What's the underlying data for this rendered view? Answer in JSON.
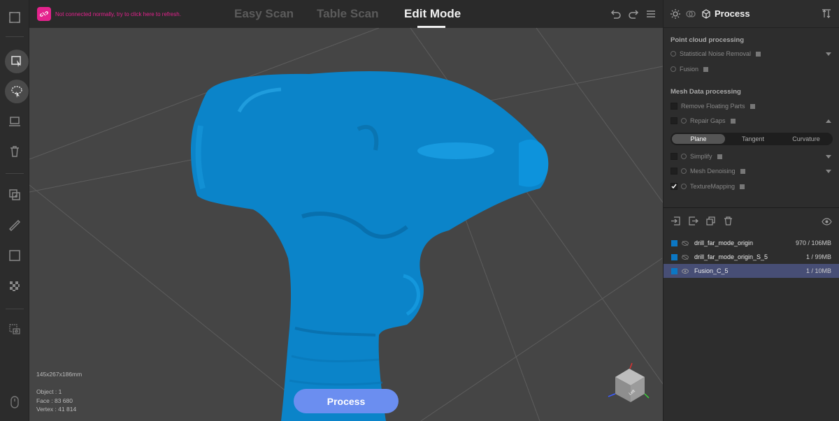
{
  "topbar": {
    "connection_warning": "Not connected normally, try to click here to refresh.",
    "tabs": [
      "Easy Scan",
      "Table Scan",
      "Edit Mode"
    ],
    "active_tab": "Edit Mode"
  },
  "viewport": {
    "dimensions": "145x267x186mm",
    "object": "Object : 1",
    "face": "Face : 83 680",
    "vertex": "Vertex : 41 814",
    "process_button": "Process",
    "cube_label": "Left"
  },
  "panel": {
    "title": "Process",
    "point_cloud": {
      "title": "Point cloud processing",
      "items": [
        "Statistical Noise Removal",
        "Fusion"
      ]
    },
    "mesh": {
      "title": "Mesh Data processing",
      "items": [
        "Remove Floating Parts",
        "Repair Gaps",
        "Simplify",
        "Mesh Denoising",
        "TextureMapping"
      ]
    },
    "repair_modes": [
      "Plane",
      "Tangent",
      "Curvature"
    ],
    "objects": [
      {
        "name": "drill_far_mode_origin",
        "size": "970 / 106MB"
      },
      {
        "name": "drill_far_mode_origin_S_5",
        "size": "1 / 99MB"
      },
      {
        "name": "Fusion_C_5",
        "size": "1 / 10MB"
      }
    ]
  },
  "colors": {
    "accent": "#6b8ef0",
    "warning": "#e4238d",
    "model": "#0b84c9",
    "selected_row": "#474e75"
  }
}
